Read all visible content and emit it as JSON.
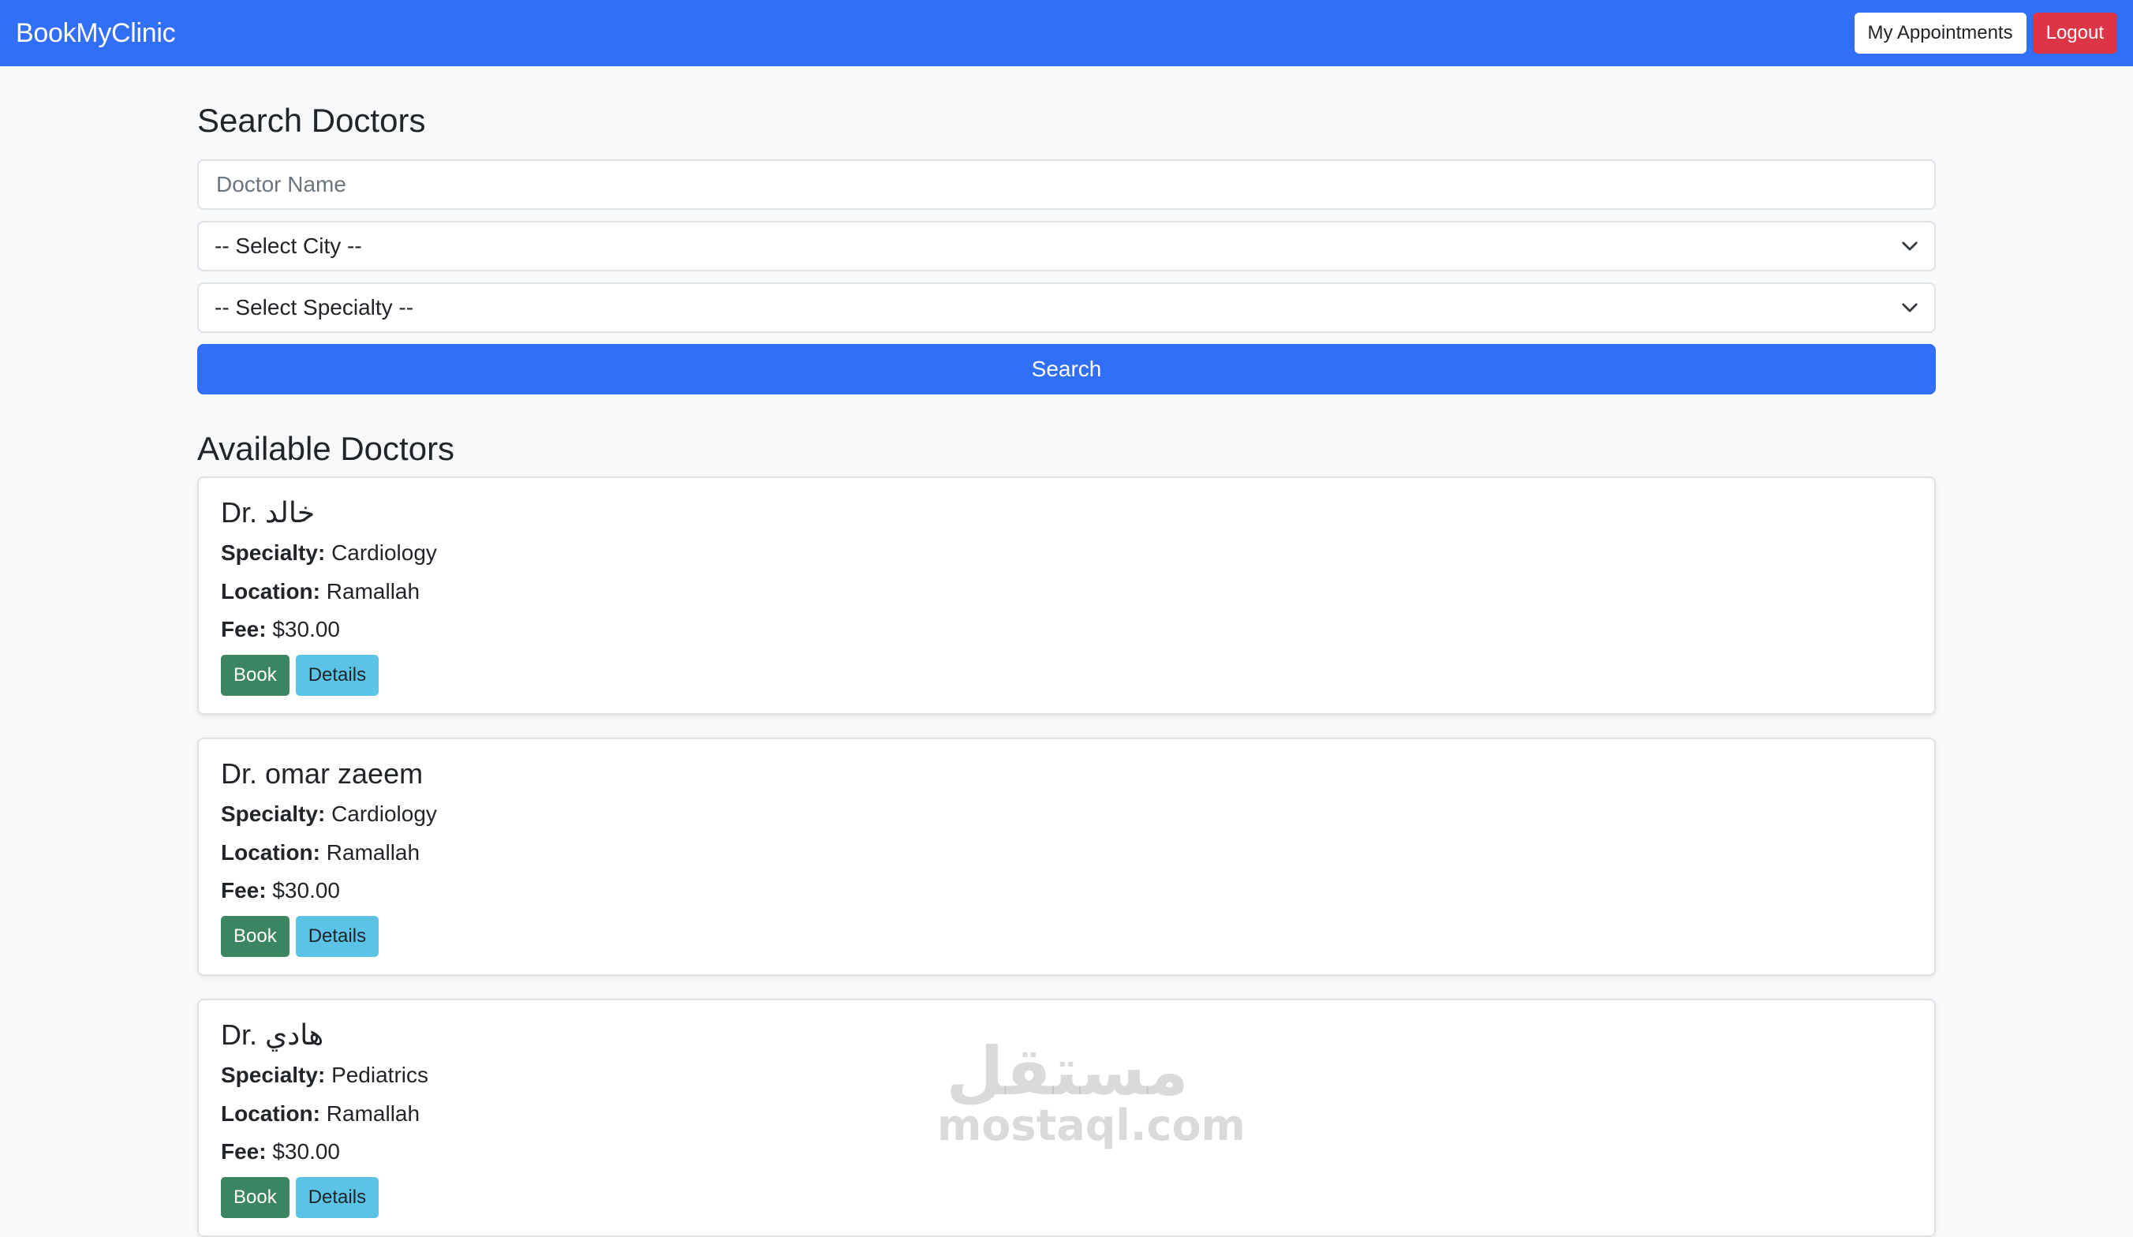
{
  "navbar": {
    "brand": "BookMyClinic",
    "my_appointments_label": "My Appointments",
    "logout_label": "Logout",
    "color": "#316ff6"
  },
  "search": {
    "title": "Search Doctors",
    "doctor_name_placeholder": "Doctor Name",
    "doctor_name_value": "",
    "city_selected": "-- Select City --",
    "specialty_selected": "-- Select Specialty --",
    "search_label": "Search"
  },
  "results": {
    "title": "Available Doctors",
    "specialty_label": "Specialty:",
    "location_label": "Location:",
    "fee_label": "Fee:",
    "book_label": "Book",
    "details_label": "Details",
    "doctors": [
      {
        "name": "Dr. خالد",
        "specialty": "Cardiology",
        "location": "Ramallah",
        "fee": "$30.00"
      },
      {
        "name": "Dr. omar zaeem",
        "specialty": "Cardiology",
        "location": "Ramallah",
        "fee": "$30.00"
      },
      {
        "name": "Dr. هادي",
        "specialty": "Pediatrics",
        "location": "Ramallah",
        "fee": "$30.00"
      }
    ]
  },
  "watermark": {
    "arabic": "مستقل",
    "latin": "mostaql.com"
  },
  "colors": {
    "book": "#3b8560",
    "details": "#5bc3e6",
    "logout": "#dc3545"
  }
}
